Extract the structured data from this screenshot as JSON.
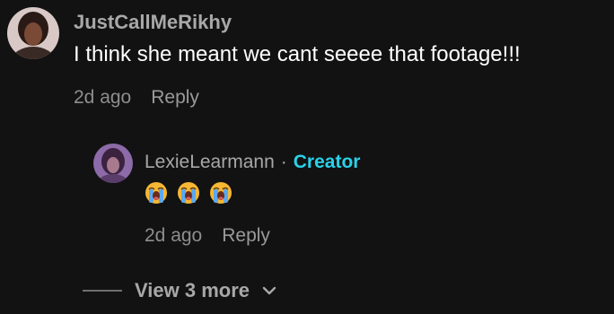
{
  "comment": {
    "username": "JustCallMeRikhy",
    "text": "I think she meant we cant seeee that footage!!!",
    "timestamp": "2d ago",
    "reply_label": "Reply",
    "avatar_icon": "user-avatar-photo"
  },
  "reply": {
    "username": "LexieLearmann",
    "separator": "·",
    "badge": "Creator",
    "emojis": [
      "😭",
      "😭",
      "😭"
    ],
    "timestamp": "2d ago",
    "reply_label": "Reply",
    "avatar_icon": "user-avatar-photo"
  },
  "view_more": {
    "label": "View 3 more",
    "icon": "chevron-down-icon"
  },
  "colors": {
    "background": "#121212",
    "creator_accent": "#2ad1e8",
    "primary_text": "#ffffff",
    "secondary_text": "#a8a8a8"
  }
}
